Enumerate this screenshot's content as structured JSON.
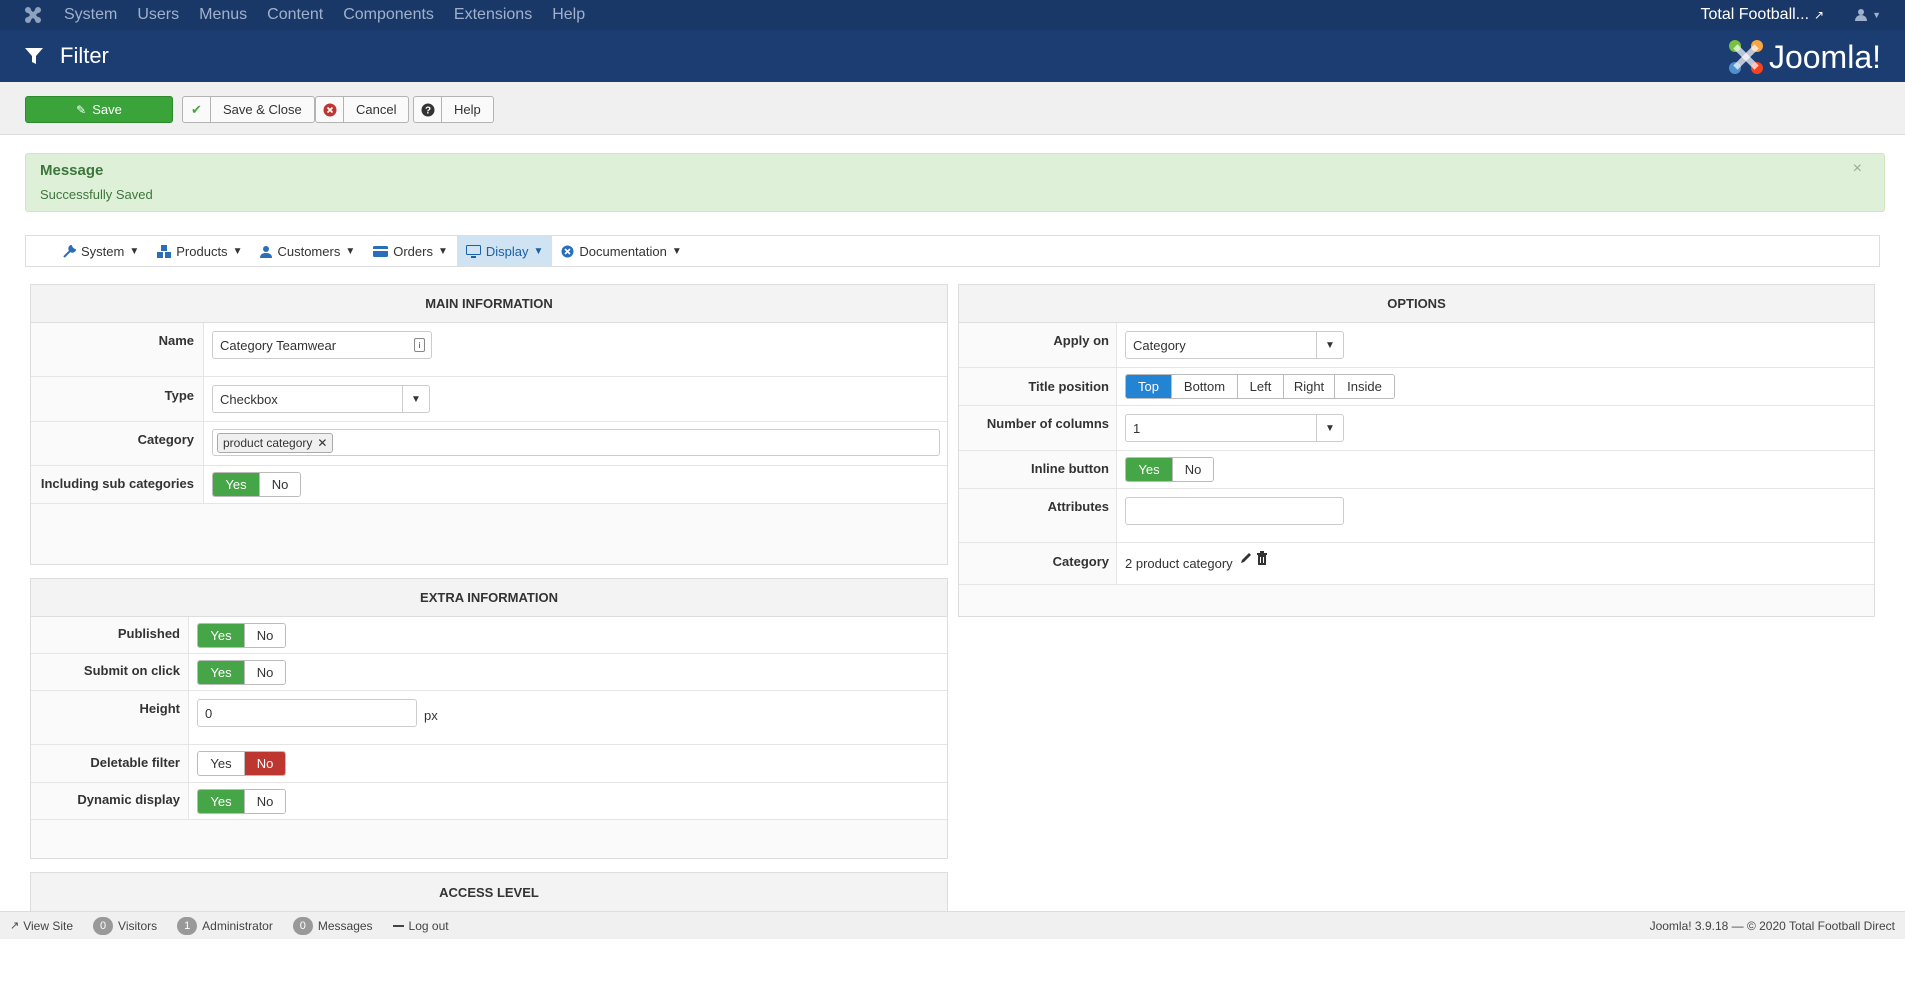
{
  "topbar": {
    "menu": [
      "System",
      "Users",
      "Menus",
      "Content",
      "Components",
      "Extensions",
      "Help"
    ],
    "site_name": "Total Football..."
  },
  "title": "Filter",
  "brand": "Joomla!",
  "toolbar": {
    "save": "Save",
    "save_close": "Save & Close",
    "cancel": "Cancel",
    "help": "Help"
  },
  "alert": {
    "heading": "Message",
    "text": "Successfully Saved",
    "close": "×"
  },
  "nav": [
    "System",
    "Products",
    "Customers",
    "Orders",
    "Display",
    "Documentation"
  ],
  "nav_active": "Display",
  "main_info": {
    "heading": "MAIN INFORMATION",
    "name_label": "Name",
    "name_value": "Category Teamwear",
    "type_label": "Type",
    "type_value": "Checkbox",
    "category_label": "Category",
    "category_chip": "product category",
    "subcat_label": "Including sub categories",
    "yes": "Yes",
    "no": "No"
  },
  "extra_info": {
    "heading": "EXTRA INFORMATION",
    "published_label": "Published",
    "submit_label": "Submit on click",
    "height_label": "Height",
    "height_value": "0",
    "height_unit": "px",
    "deletable_label": "Deletable filter",
    "dynamic_label": "Dynamic display"
  },
  "access": {
    "heading": "ACCESS LEVEL"
  },
  "options": {
    "heading": "OPTIONS",
    "apply_label": "Apply on",
    "apply_value": "Category",
    "title_pos_label": "Title position",
    "title_pos_options": [
      "Top",
      "Bottom",
      "Left",
      "Right",
      "Inside"
    ],
    "title_pos_selected": "Top",
    "columns_label": "Number of columns",
    "columns_value": "1",
    "inline_label": "Inline button",
    "attributes_label": "Attributes",
    "attributes_value": "",
    "category_label": "Category",
    "category_value": "2 product category"
  },
  "status": {
    "view_site": "View Site",
    "visitors_count": "0",
    "visitors": "Visitors",
    "admin_count": "1",
    "admin": "Administrator",
    "messages_count": "0",
    "messages": "Messages",
    "logout": "Log out",
    "footer": "Joomla! 3.9.18 — © 2020 Total Football Direct"
  }
}
